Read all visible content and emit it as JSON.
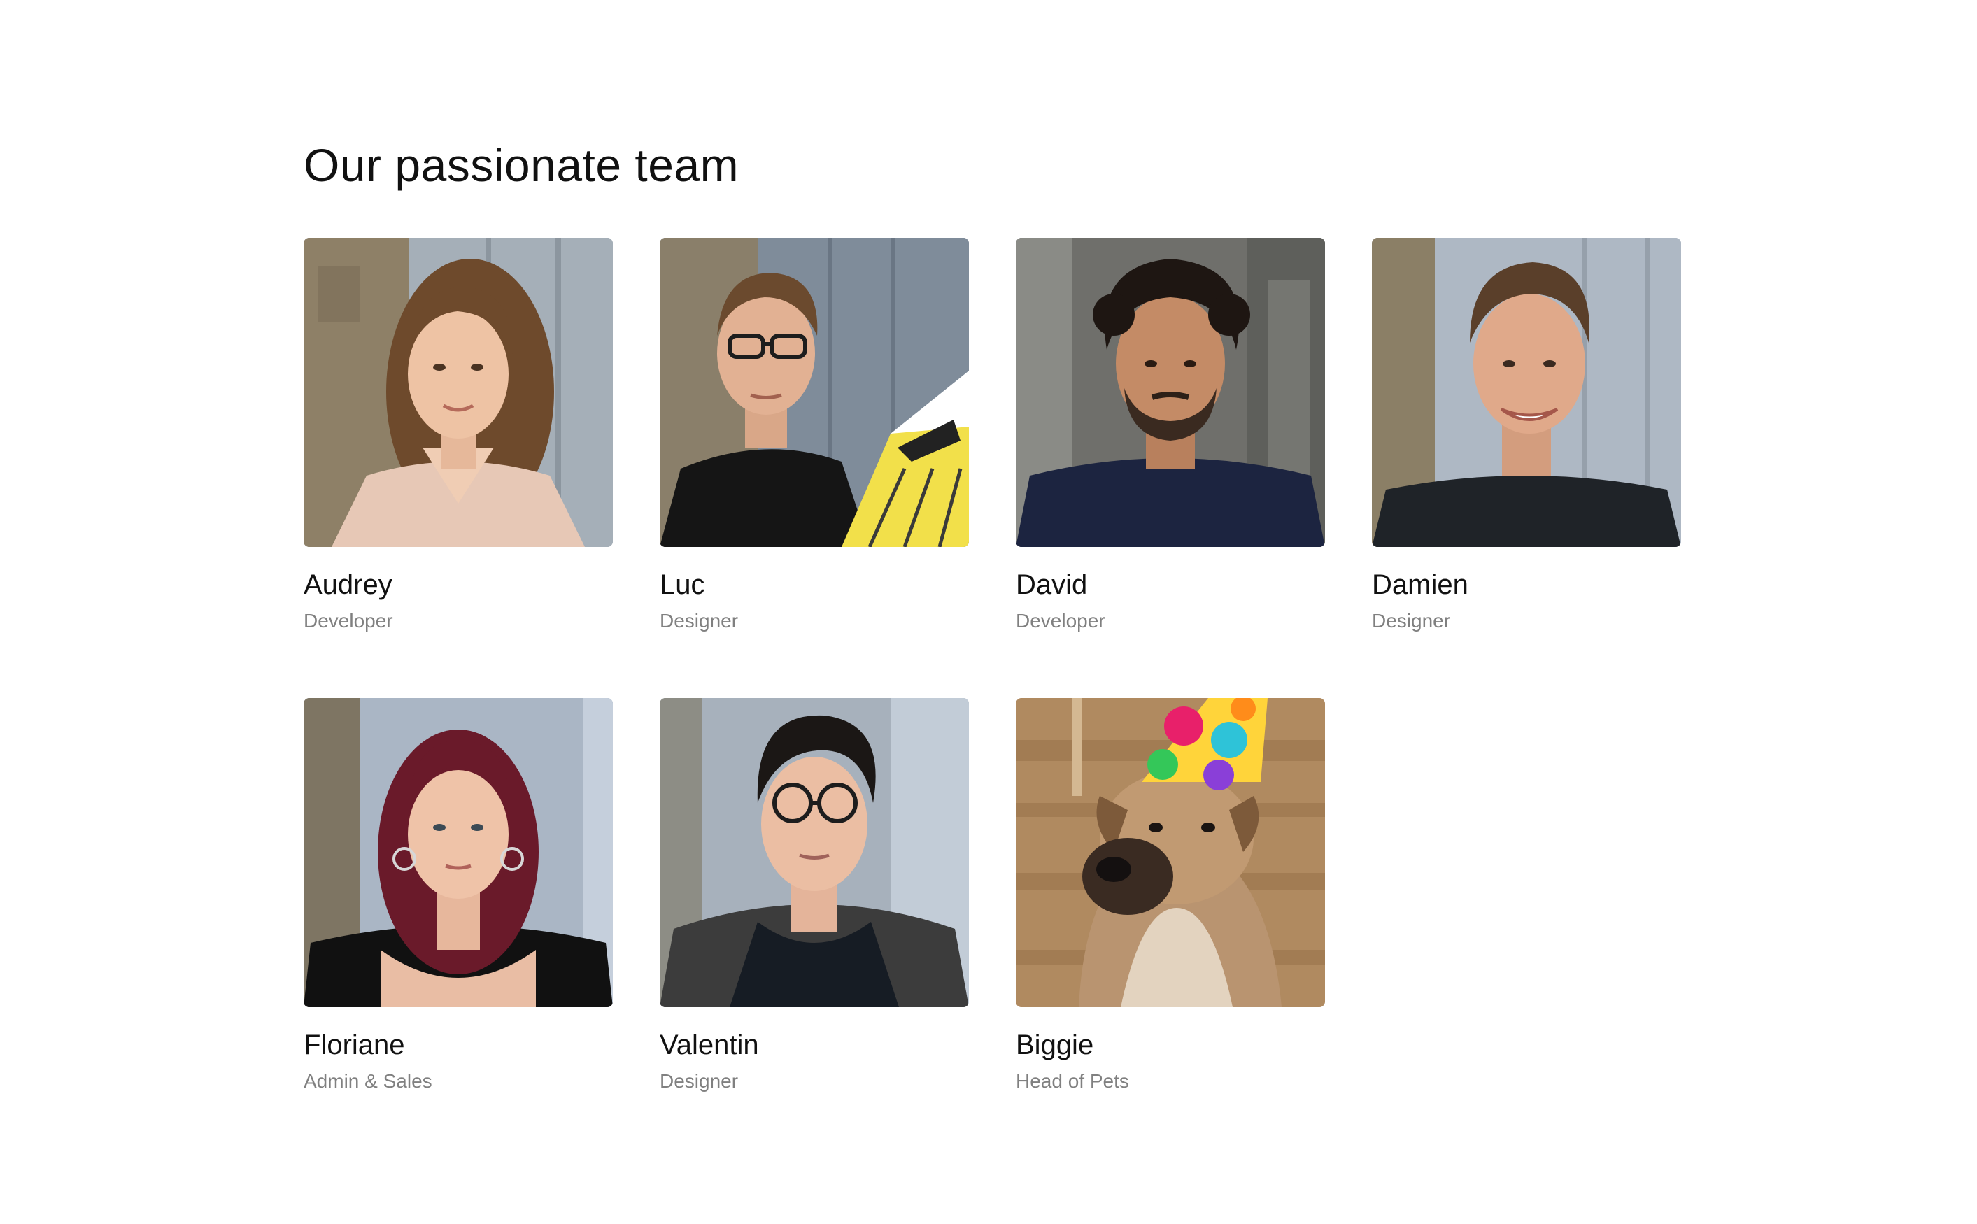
{
  "section": {
    "title": "Our passionate team"
  },
  "team": [
    {
      "name": "Audrey",
      "role": "Developer"
    },
    {
      "name": "Luc",
      "role": "Designer"
    },
    {
      "name": "David",
      "role": "Developer"
    },
    {
      "name": "Damien",
      "role": "Designer"
    },
    {
      "name": "Floriane",
      "role": "Admin & Sales"
    },
    {
      "name": "Valentin",
      "role": "Designer"
    },
    {
      "name": "Biggie",
      "role": "Head of Pets"
    }
  ],
  "colors": {
    "title": "#111111",
    "name": "#111111",
    "role": "#808080",
    "background": "#ffffff"
  }
}
